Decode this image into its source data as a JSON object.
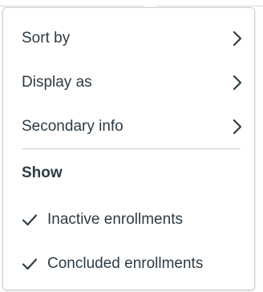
{
  "menu": {
    "items": [
      {
        "label": "Sort by",
        "icon": "chevron-right-icon"
      },
      {
        "label": "Display as",
        "icon": "chevron-right-icon"
      },
      {
        "label": "Secondary info",
        "icon": "chevron-right-icon"
      }
    ],
    "show_heading": "Show",
    "show_options": [
      {
        "label": "Inactive enrollments",
        "checked": true,
        "icon": "checkmark-icon"
      },
      {
        "label": "Concluded enrollments",
        "checked": true,
        "icon": "checkmark-icon"
      }
    ]
  },
  "colors": {
    "text": "#2d3b45",
    "border": "#c7cdd1",
    "background": "#ffffff"
  }
}
